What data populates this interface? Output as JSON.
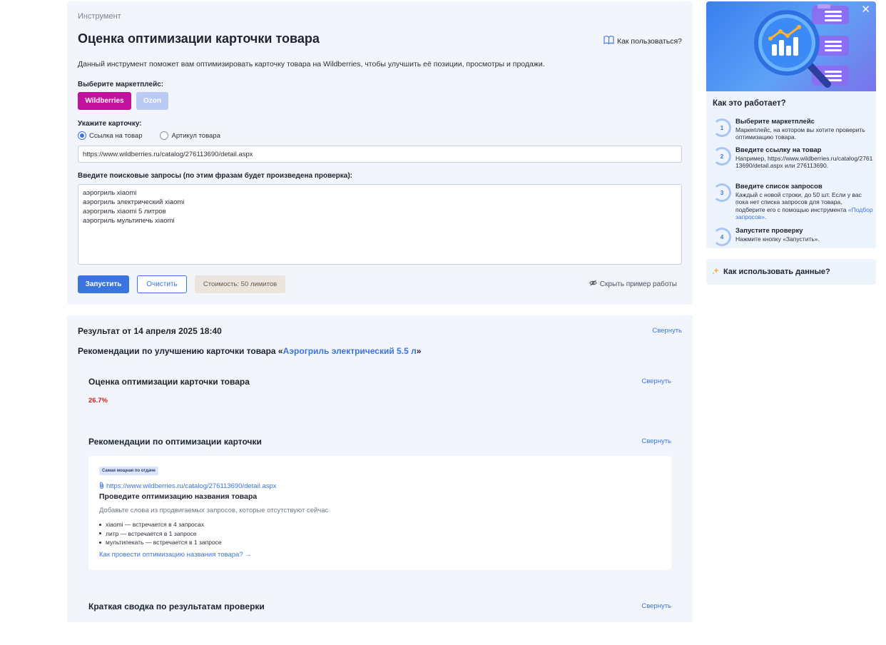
{
  "tool": {
    "breadcrumb": "Инструмент",
    "title": "Оценка оптимизации карточки товара",
    "how_to_use": "Как пользоваться?",
    "description": "Данный инструмент поможет вам оптимизировать карточку товара на Wildberries, чтобы улучшить её позиции, просмотры и продажи.",
    "marketplace_label": "Выберите маркетплейс:",
    "marketplaces": [
      "Wildberries",
      "Ozon"
    ],
    "card_label": "Укажите карточку:",
    "radio_options": [
      "Ссылка на товар",
      "Артикул товара"
    ],
    "url_value": "https://www.wildberries.ru/catalog/276113690/detail.aspx",
    "queries_label": "Введите поисковые запросы (по этим фразам будет произведена проверка):",
    "queries": [
      "аэрогриль xiaomi",
      "аэрогриль электрический xiaomi",
      "аэрогриль xiaomi 5 литров",
      "аэрогриль мультипечь xiaomi"
    ],
    "run_button": "Запустить",
    "clear_button": "Очистить",
    "cost": "Стоимость: 50 лимитов",
    "hide_example": "Скрыть пример работы"
  },
  "result": {
    "title": "Результат от 14 апреля 2025 18:40",
    "collapse": "Свернуть",
    "rec_prefix": "Рекомендации по улучшению карточки товара «",
    "rec_product": "Аэрогриль электрический 5.5 л",
    "rec_suffix": "»",
    "section_score_title": "Оценка оптимизации карточки товара",
    "score": "26.7%",
    "section_recs_title": "Рекомендации по оптимизации карточки",
    "card": {
      "badge": "Самая мощная по отдаче",
      "link": "https://www.wildberries.ru/catalog/276113690/detail.aspx",
      "heading": "Проведите оптимизацию названия товара",
      "subtitle": "Добавьте слова из продвигаемых запросов, которые отсутствуют сейчас",
      "items": [
        "xiaomi — встречается в 4 запросах",
        "литр — встречается в 1 запросе",
        "мультипекать — встречается в 1 запросе"
      ],
      "more": "Как провести оптимизацию названия товара? →"
    },
    "section_summary_title": "Краткая сводка по результатам проверки"
  },
  "sidebar": {
    "how_title": "Как это работает?",
    "steps": [
      {
        "num": "1",
        "title": "Выберите маркетплейс",
        "text": "Маркеплейс, на котором вы хотите проверить оптимизацию товара."
      },
      {
        "num": "2",
        "title": "Введите ссылку на товар",
        "text": "Например, https://www.wildberries.ru/catalog/276113690/detail.aspx или 276113690."
      },
      {
        "num": "3",
        "title": "Введите список запросов",
        "text": "Каждый с новой строки, до 50 шт. Если у вас пока нет списка запросов для товара, подберите его с помощью инструмента",
        "link": "«Подбор запросов»",
        "tail": "."
      },
      {
        "num": "4",
        "title": "Запустите проверку",
        "text": "Нажмите кнопку «Запустить»."
      }
    ],
    "use_data": "Как использовать данные?"
  },
  "colors": {
    "accent": "#3b74e0",
    "wildberries": "#c2119c",
    "ozon": "#b9cbf4",
    "score": "#d21f1f",
    "panel_bg": "#f2f6fc"
  }
}
